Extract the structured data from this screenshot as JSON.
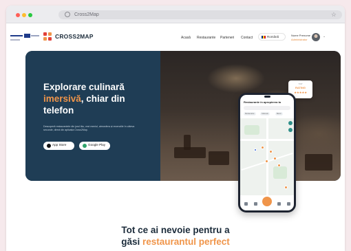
{
  "browser": {
    "url": "Cross2Map"
  },
  "header": {
    "brand": "CROSS2MAP",
    "nav": [
      "Acasă",
      "Restaurante",
      "Parteneri",
      "Contact"
    ],
    "language": "Română",
    "user_name": "Nume Prenume",
    "user_role": "Administrator"
  },
  "hero": {
    "title_line1": "Explorare culinară",
    "title_accent": "imersivă",
    "title_rest": ", chiar din telefon",
    "description": "Descoperă restaurantele din jurul tău, vezi meniul, atmosfera și recenziile în câteva secunde, direct din aplicația Cross2Map.",
    "app_store": "App Store",
    "google_play": "Google Play"
  },
  "phone": {
    "title": "Restaurante în apropierea ta",
    "chips": [
      "Restaurante",
      "Cafenele",
      "Baruri"
    ]
  },
  "rating": {
    "top": "TOP",
    "label": "RATING",
    "stars": "★★★★★",
    "value_out_of_5": 5
  },
  "section": {
    "line1": "Tot ce ai nevoie pentru a",
    "line2_prefix": "găsi ",
    "line2_accent": "restaurantul perfect"
  },
  "colors": {
    "accent": "#f0954a",
    "hero_panel": "#1f3d55",
    "heading": "#1b2b3a"
  }
}
